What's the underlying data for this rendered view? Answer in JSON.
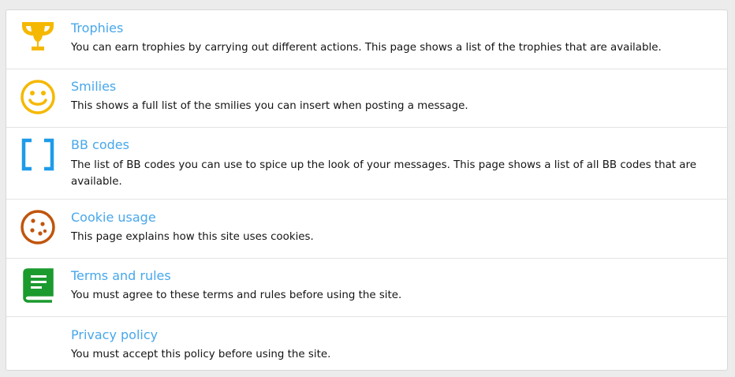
{
  "items": [
    {
      "title": "Trophies",
      "description": "You can earn trophies by carrying out different actions. This page shows a list of the trophies that are available.",
      "icon": "trophy-icon",
      "icon_color": "#f5b800"
    },
    {
      "title": "Smilies",
      "description": "This shows a full list of the smilies you can insert when posting a message.",
      "icon": "smiley-icon",
      "icon_color": "#f5b800"
    },
    {
      "title": "BB codes",
      "description": "The list of BB codes you can use to spice up the look of your messages. This page shows a list of all BB codes that are available.",
      "icon": "brackets-icon",
      "icon_color": "#1e9bea"
    },
    {
      "title": "Cookie usage",
      "description": "This page explains how this site uses cookies.",
      "icon": "cookie-icon",
      "icon_color": "#c0550c"
    },
    {
      "title": "Terms and rules",
      "description": "You must agree to these terms and rules before using the site.",
      "icon": "book-icon",
      "icon_color": "#1b9a2e"
    },
    {
      "title": "Privacy policy",
      "description": "You must accept this policy before using the site.",
      "icon": "",
      "icon_color": ""
    }
  ],
  "colors": {
    "link": "#47a7eb",
    "text": "#141414",
    "background": "#ececec",
    "panel": "#ffffff"
  }
}
